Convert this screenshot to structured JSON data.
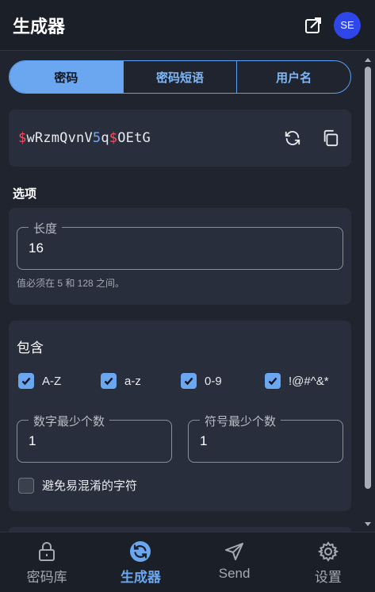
{
  "header": {
    "title": "生成器",
    "avatar_initials": "SE"
  },
  "type_tabs": [
    {
      "label": "密码",
      "selected": true
    },
    {
      "label": "密码短语",
      "selected": false
    },
    {
      "label": "用户名",
      "selected": false
    }
  ],
  "password": {
    "parts": [
      {
        "text": "$",
        "kind": "symbol"
      },
      {
        "text": "wRzmQvnV",
        "kind": "letter"
      },
      {
        "text": "5",
        "kind": "number"
      },
      {
        "text": "q",
        "kind": "letter"
      },
      {
        "text": "$",
        "kind": "symbol"
      },
      {
        "text": "OEtG",
        "kind": "letter"
      }
    ]
  },
  "options": {
    "section_label": "选项",
    "length_label": "长度",
    "length_value": "16",
    "length_hint": "值必须在 5 和 128 之间。"
  },
  "include": {
    "title": "包含",
    "checkboxes": [
      {
        "label": "A-Z",
        "checked": true
      },
      {
        "label": "a-z",
        "checked": true
      },
      {
        "label": "0-9",
        "checked": true
      },
      {
        "label": "!@#^&*",
        "checked": true
      }
    ],
    "min_numbers_label": "数字最少个数",
    "min_numbers_value": "1",
    "min_special_label": "符号最少个数",
    "min_special_value": "1",
    "avoid_ambiguous_label": "避免易混淆的字符",
    "avoid_ambiguous_checked": false
  },
  "nav": [
    {
      "label": "密码库",
      "icon": "lock-icon",
      "active": false
    },
    {
      "label": "生成器",
      "icon": "generator-icon",
      "active": true
    },
    {
      "label": "Send",
      "icon": "send-icon",
      "active": false
    },
    {
      "label": "设置",
      "icon": "gear-icon",
      "active": false
    }
  ],
  "colors": {
    "accent": "#6aa7f0",
    "avatar": "#2f47e8",
    "symbol": "#ff4d5e",
    "number": "#6ea8ff"
  }
}
